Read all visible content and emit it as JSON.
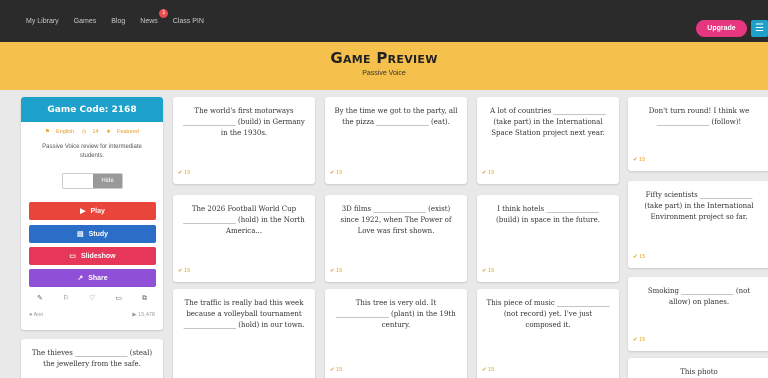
{
  "nav": {
    "items": [
      {
        "label": "My Library"
      },
      {
        "label": "Games"
      },
      {
        "label": "Blog"
      },
      {
        "label": "News",
        "badge": "1"
      },
      {
        "label": "Class PIN"
      }
    ],
    "upgrade_label": "Upgrade",
    "menu_icon": "menu-icon"
  },
  "header": {
    "title": "Game Preview",
    "subtitle": "Passive Voice"
  },
  "side": {
    "code_label": "Game Code: 2168",
    "meta": {
      "language": "English",
      "count": "14",
      "featured": "Featured"
    },
    "description": "Passive Voice review for intermediate students.",
    "hide_label": "Hide",
    "actions": {
      "play": "Play",
      "study": "Study",
      "slideshow": "Slideshow",
      "share": "Share"
    },
    "author": "Ann",
    "plays": "15,478"
  },
  "cards": [
    {
      "text": "The world's first motorways _______________ (build) in Germany in the 1930s.",
      "mark": "✔ 15"
    },
    {
      "text": "By the time we got to the party, all the pizza _______________ (eat).",
      "mark": "✔ 15"
    },
    {
      "text": "A lot of countries _______________ (take part) in the International Space Station project next year.",
      "mark": "✔ 15"
    },
    {
      "text": "Don't turn round! I think we _______________ (follow)!",
      "mark": "✔ 15"
    },
    {
      "text": "The 2026 Football World Cup _______________ (hold) in the North America...",
      "mark": "✔ 15"
    },
    {
      "text": "3D films _______________ (exist) since 1922, when The Power of Love was first shown.",
      "mark": "✔ 15"
    },
    {
      "text": "I think hotels _______________ (build) in space in the future.",
      "mark": "✔ 15"
    },
    {
      "text": "Fifty scientists _______________ (take part) in the International Environment project so far.",
      "mark": "✔ 15"
    },
    {
      "text": "The traffic is really bad this week because a volleyball tournament _______________ (hold) in our town.",
      "mark": "✔ 15"
    },
    {
      "text": "This tree is very old. It _______________ (plant) in the 19th century.",
      "mark": "✔ 15"
    },
    {
      "text": "This piece of music _______________ (not record) yet. I've just composed it.",
      "mark": "✔ 15"
    },
    {
      "text": "Smoking _______________ (not allow) on planes.",
      "mark": "✔ 15"
    },
    {
      "text": "The thieves _______________ (steal) the jewellery from the safe.",
      "mark": ""
    },
    {
      "text": "This photo",
      "mark": ""
    }
  ]
}
